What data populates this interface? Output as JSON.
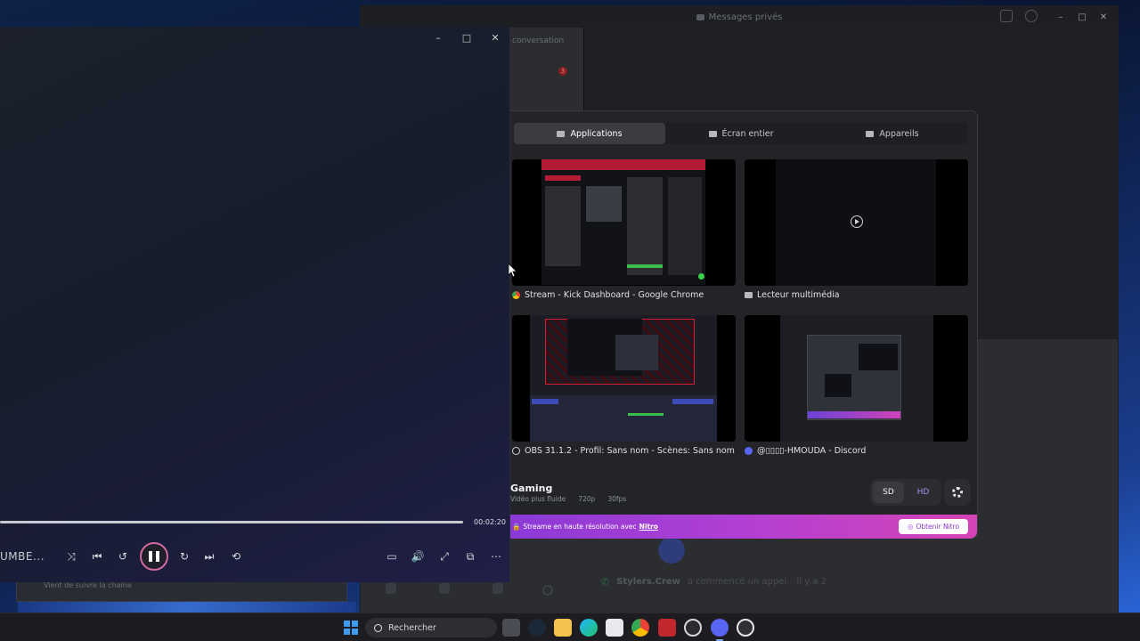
{
  "discord": {
    "window_title": "Messages privés",
    "conversation_label": "conversation",
    "unread_count": "3",
    "call_user": "Stylers.Crew",
    "call_text": "a commencé un appel.",
    "call_time": "Il y a 2"
  },
  "player": {
    "time": "00:02:20",
    "song_title": "UMBE...",
    "below_label": "Vient de suivre la chaîne",
    "minimize": "–",
    "maximize": "□",
    "close": "✕",
    "controls": {
      "shuffle": "⤨",
      "previous": "⏮",
      "rewind": "↺",
      "forward": "↻",
      "next": "⏭",
      "repeat": "⟲",
      "subtitles": "▭",
      "volume": "🔊",
      "fullscreen": "⤢",
      "miniplayer": "⧉",
      "more": "⋯"
    }
  },
  "picker": {
    "tabs": [
      {
        "label": "Applications",
        "active": true
      },
      {
        "label": "Écran entier",
        "active": false
      },
      {
        "label": "Appareils",
        "active": false
      }
    ],
    "windows": [
      {
        "label": "Stream - Kick Dashboard - Google Chrome",
        "icon": "chrome-icon"
      },
      {
        "label": "Lecteur multimédia",
        "icon": "media-player-icon"
      },
      {
        "label": "OBS 31.1.2 - Profil: Sans nom - Scènes: Sans nom",
        "icon": "obs-icon"
      },
      {
        "label": "@▯▯▯▯-HMOUDA - Discord",
        "icon": "discord-icon"
      }
    ],
    "quality": {
      "title": "Gaming",
      "subtitle": "Vidéo plus fluide",
      "resolution": "720p",
      "fps": "30fps",
      "sd_label": "SD",
      "hd_label": "HD"
    },
    "nitro": {
      "text": "Streame en haute résolution avec",
      "link": "Nitro",
      "button": "Obtenir Nitro"
    }
  },
  "taskbar": {
    "search_placeholder": "Rechercher",
    "apps": [
      "file-explorer-icon",
      "steam-icon",
      "folder-icon",
      "edge-icon",
      "store-icon",
      "chrome-icon",
      "tiktok-live-icon",
      "obs-icon",
      "discord-icon",
      "media-player-icon"
    ]
  }
}
